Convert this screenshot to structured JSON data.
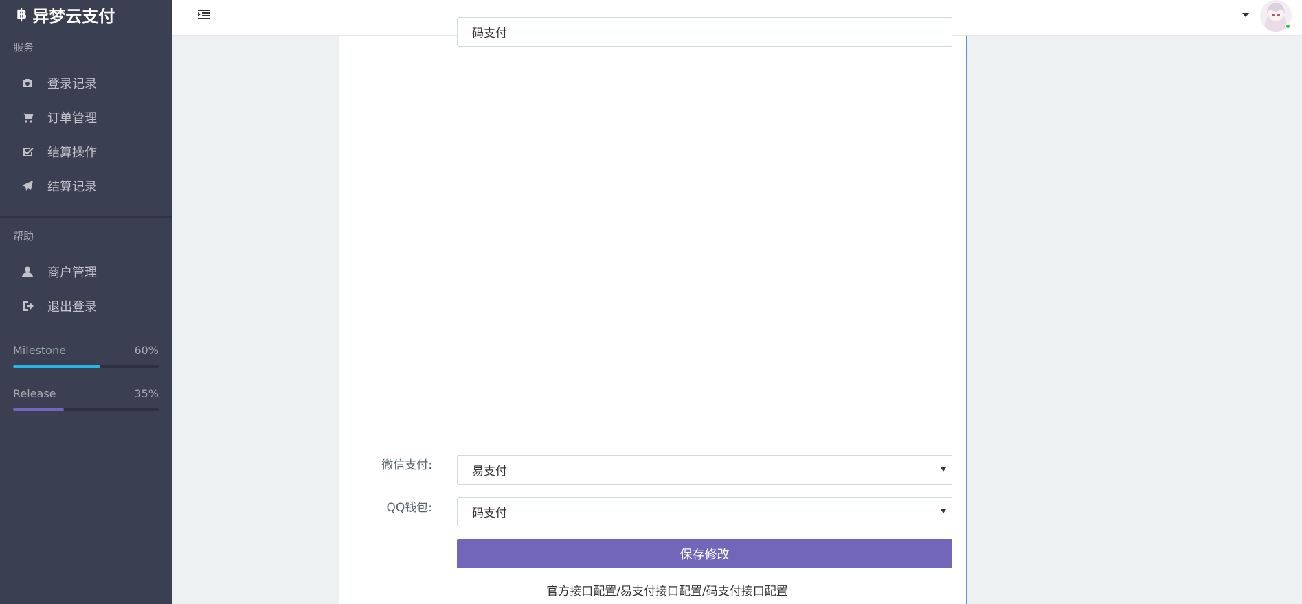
{
  "brand": {
    "icon": "bitcoin-icon",
    "glyph": "฿",
    "name": "异梦云支付"
  },
  "sidebar": {
    "section_service": "服务",
    "service_items": [
      {
        "label": "登录记录",
        "icon": "camera-icon"
      },
      {
        "label": "订单管理",
        "icon": "cart-icon"
      },
      {
        "label": "结算操作",
        "icon": "check-square-icon"
      },
      {
        "label": "结算记录",
        "icon": "send-icon"
      }
    ],
    "section_help": "帮助",
    "help_items": [
      {
        "label": "商户管理",
        "icon": "user-icon"
      },
      {
        "label": "退出登录",
        "icon": "sign-out-icon"
      }
    ],
    "progress": [
      {
        "label": "Milestone",
        "value_text": "60%",
        "value": 0.6,
        "color": "#23b7e5"
      },
      {
        "label": "Release",
        "value_text": "35%",
        "value": 0.35,
        "color": "#7266ba"
      }
    ]
  },
  "header": {
    "menu_icon": "indent-icon",
    "avatar": "avatar-image"
  },
  "form": {
    "top_field_value": "码支付",
    "fields": [
      {
        "label": "微信支付:",
        "value": "易支付"
      },
      {
        "label": "QQ钱包:",
        "value": "码支付"
      }
    ],
    "save_label": "保存修改",
    "footer_links": "官方接口配置/易支付接口配置/码支付接口配置"
  },
  "colors": {
    "sidebar_bg": "#3a3f51",
    "primary": "#7266ba",
    "info": "#23b7e5",
    "online": "#27c24c"
  }
}
